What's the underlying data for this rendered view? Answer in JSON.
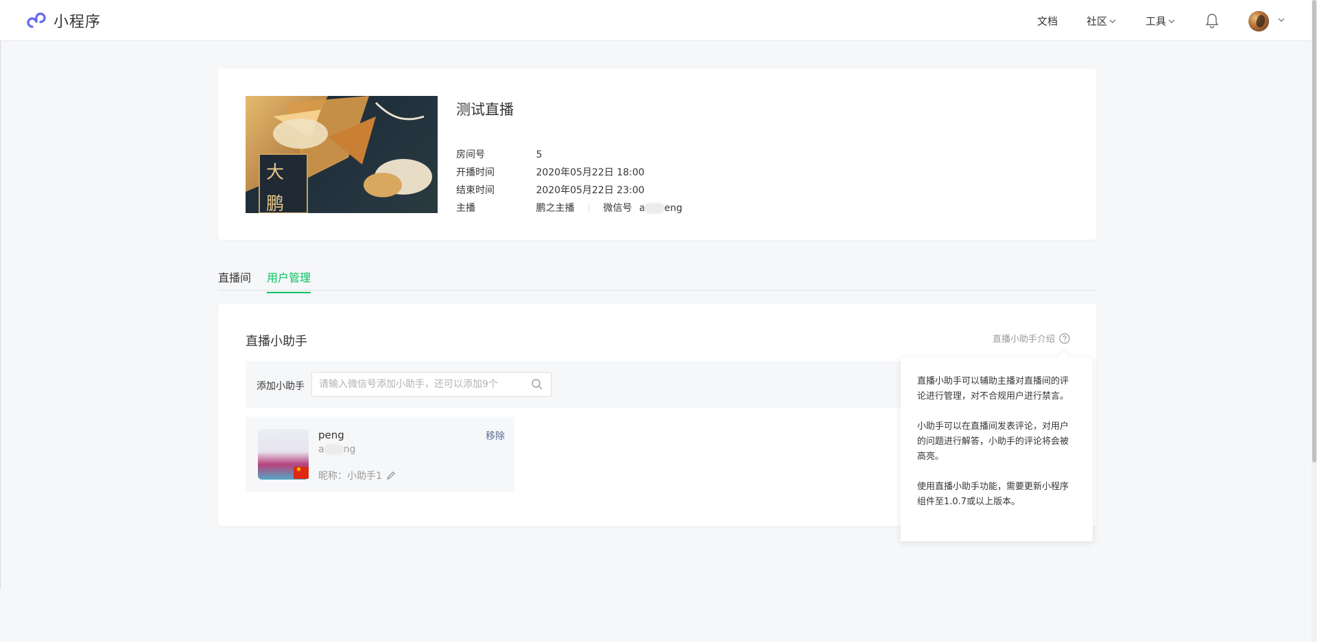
{
  "header": {
    "app_name": "小程序",
    "nav": [
      {
        "label": "文档"
      },
      {
        "label": "社区"
      },
      {
        "label": "工具"
      }
    ]
  },
  "live": {
    "title": "测试直播",
    "rows": [
      {
        "label": "房间号",
        "value": "5"
      },
      {
        "label": "开播时间",
        "value": "2020年05月22日 18:00"
      },
      {
        "label": "结束时间",
        "value": "2020年05月22日 23:00"
      }
    ],
    "anchor": {
      "label": "主播",
      "name": "鹏之主播",
      "wechat_label": "微信号",
      "wechat_prefix": "a",
      "wechat_suffix": "eng"
    }
  },
  "tabs": [
    {
      "label": "直播间",
      "active": false
    },
    {
      "label": "用户管理",
      "active": true
    }
  ],
  "assistants": {
    "title": "直播小助手",
    "intro_link": "直播小助手介绍",
    "add_label": "添加小助手",
    "search_placeholder": "请输入微信号添加小助手，还可以添加9个",
    "items": [
      {
        "name": "peng",
        "wechat_prefix": "a",
        "wechat_suffix": "ng",
        "nickname": "昵称：小助手1",
        "remove_label": "移除"
      }
    ]
  },
  "popover": {
    "paragraphs": [
      "直播小助手可以辅助主播对直播间的评论进行管理，对不合规用户进行禁言。",
      "小助手可以在直播间发表评论，对用户的问题进行解答，小助手的评论将会被高亮。",
      "使用直播小助手功能，需要更新小程序组件至1.0.7或以上版本。"
    ]
  },
  "colors": {
    "accent_green": "#07c160",
    "link_blue": "#576b95",
    "brand_purple": "#6467f0"
  },
  "icons": [
    "miniprogram-logo-icon",
    "chevron-down-icon",
    "bell-icon",
    "avatar",
    "help-icon",
    "search-icon",
    "edit-icon",
    "china-flag-icon"
  ]
}
